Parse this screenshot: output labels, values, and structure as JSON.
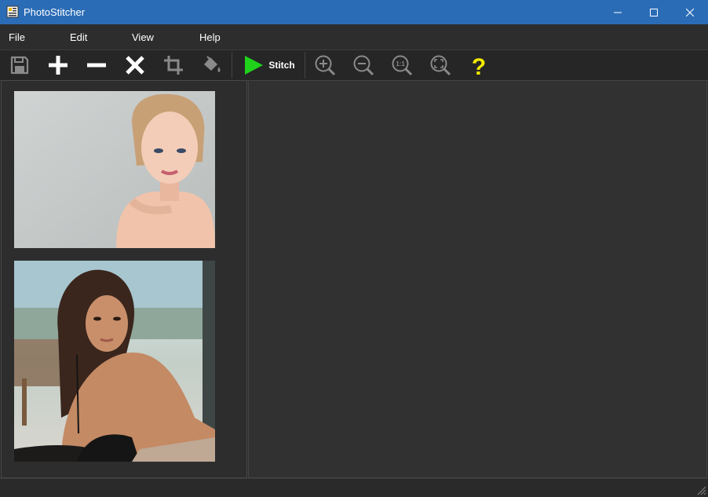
{
  "window": {
    "title": "PhotoStitcher"
  },
  "menu": {
    "file": "File",
    "edit": "Edit",
    "view": "View",
    "help": "Help"
  },
  "toolbar": {
    "stitch_label": "Stitch",
    "icons": [
      "save-icon",
      "add-icon",
      "remove-icon",
      "clear-icon",
      "crop-icon",
      "fill-color-icon",
      "play-icon",
      "zoom-in-icon",
      "zoom-out-icon",
      "actual-size-icon",
      "fit-to-window-icon",
      "help-icon"
    ],
    "actual_size_text": "1:1",
    "help_glyph": "?"
  },
  "colors": {
    "titlebar": "#2b6cb6",
    "stitch_green": "#1fd21a",
    "help_yellow": "#f3ea00"
  },
  "photos": [
    {
      "description": "blonde-woman-portrait"
    },
    {
      "description": "brunette-woman-black-dress"
    }
  ]
}
